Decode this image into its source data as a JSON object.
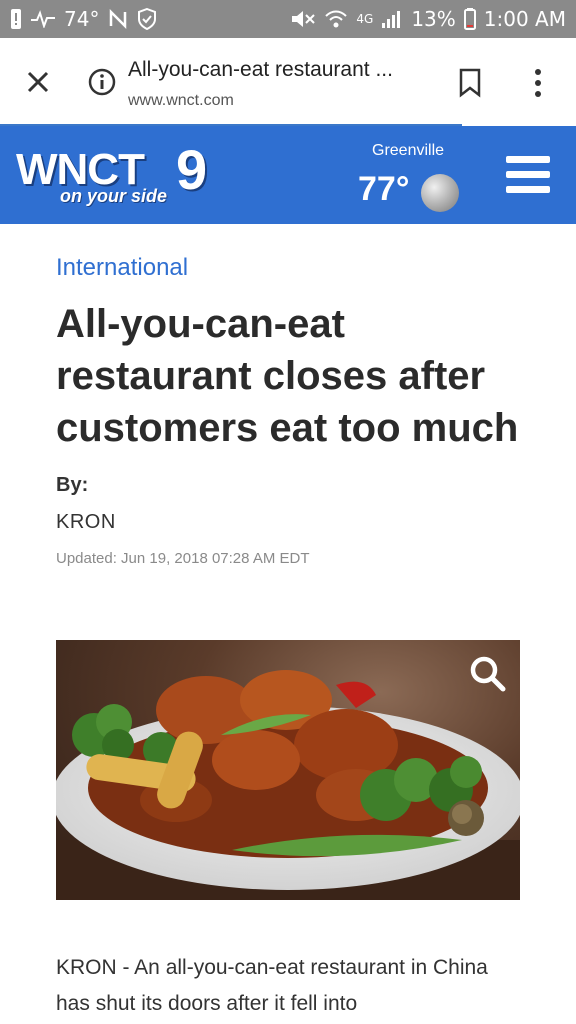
{
  "status_bar": {
    "temperature": "74°",
    "battery_pct": "13%",
    "time": "1:00 AM",
    "network_label": "4G"
  },
  "browser": {
    "page_title": "All-you-can-eat restaurant ...",
    "domain": "www.wnct.com"
  },
  "site_header": {
    "logo_text": "WNCT",
    "logo_number": "9",
    "logo_tagline": "on your side",
    "weather_city": "Greenville",
    "weather_temp": "77°",
    "accent_color": "#2f6fd1"
  },
  "article": {
    "category": "International",
    "headline": "All-you-can-eat restaurant closes after customers eat too much",
    "byline_label": "By:",
    "byline_name": "KRON",
    "updated": "Updated: Jun 19, 2018 07:28 AM EDT",
    "body_text": "KRON - An all-you-can-eat restaurant in China has shut its doors after it fell into"
  },
  "icons": {
    "close": "close-icon",
    "info": "info-icon",
    "bookmark": "bookmark-icon",
    "menu": "more-vert-icon",
    "hamburger": "hamburger-menu-icon",
    "zoom": "search-zoom-icon",
    "weather": "moon-icon"
  }
}
